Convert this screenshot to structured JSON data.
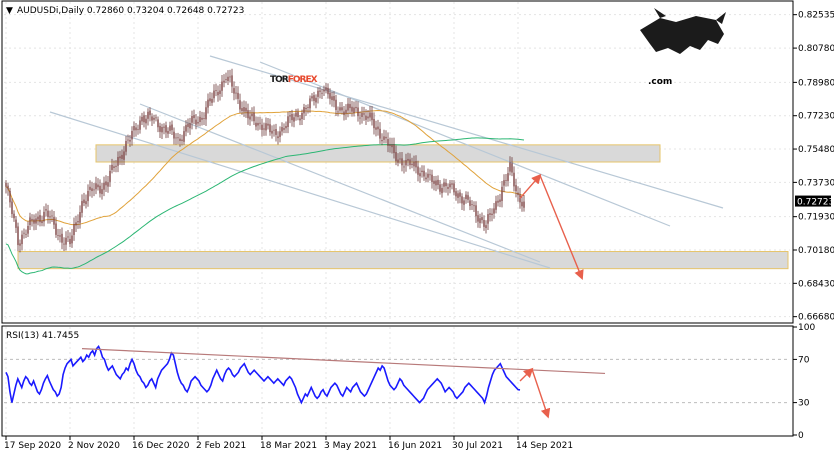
{
  "chart_data": [
    {
      "type": "candlestick",
      "title": "AUDUSDi,Daily  0.72860 0.73204 0.72648 0.72723",
      "symbol_marker": "▼",
      "current_price_label": "0.72723",
      "current_price": 0.72723,
      "ylim": [
        0.664,
        0.832
      ],
      "y_ticks": [
        "0.82535",
        "0.80780",
        "0.78980",
        "0.77230",
        "0.75480",
        "0.73730",
        "0.71930",
        "0.70180",
        "0.68430",
        "0.66680"
      ],
      "x_ticks": [
        "17 Sep 2020",
        "2 Nov 2020",
        "16 Dec 2020",
        "2 Feb 2021",
        "18 Mar 2021",
        "3 May 2021",
        "16 Jun 2021",
        "30 Jul 2021",
        "14 Sep 2021"
      ],
      "grid": true,
      "n_bars": 260,
      "closes_anchors": [
        [
          0,
          0.735
        ],
        [
          6,
          0.707
        ],
        [
          12,
          0.715
        ],
        [
          20,
          0.722
        ],
        [
          26,
          0.71
        ],
        [
          32,
          0.705
        ],
        [
          38,
          0.727
        ],
        [
          45,
          0.735
        ],
        [
          50,
          0.736
        ],
        [
          56,
          0.75
        ],
        [
          62,
          0.76
        ],
        [
          68,
          0.772
        ],
        [
          74,
          0.77
        ],
        [
          80,
          0.765
        ],
        [
          86,
          0.76
        ],
        [
          92,
          0.768
        ],
        [
          98,
          0.772
        ],
        [
          104,
          0.783
        ],
        [
          110,
          0.793
        ],
        [
          116,
          0.781
        ],
        [
          122,
          0.77
        ],
        [
          128,
          0.768
        ],
        [
          134,
          0.762
        ],
        [
          140,
          0.768
        ],
        [
          146,
          0.773
        ],
        [
          152,
          0.778
        ],
        [
          158,
          0.788
        ],
        [
          164,
          0.778
        ],
        [
          170,
          0.775
        ],
        [
          176,
          0.775
        ],
        [
          182,
          0.77
        ],
        [
          188,
          0.762
        ],
        [
          194,
          0.752
        ],
        [
          200,
          0.747
        ],
        [
          206,
          0.745
        ],
        [
          212,
          0.738
        ],
        [
          218,
          0.736
        ],
        [
          224,
          0.733
        ],
        [
          230,
          0.728
        ],
        [
          236,
          0.72
        ],
        [
          240,
          0.715
        ],
        [
          244,
          0.723
        ],
        [
          248,
          0.735
        ],
        [
          252,
          0.744
        ],
        [
          256,
          0.73
        ],
        [
          259,
          0.7272
        ]
      ],
      "sma_orange_color": "#e0a23a",
      "sma_green_color": "#2bb673",
      "zones": [
        {
          "from": 0.748,
          "to": 0.757
        },
        {
          "from": 0.692,
          "to": 0.701
        }
      ],
      "channel_color": "#b8c8d6",
      "forecast_color": "#e8604c",
      "forecast_points": [
        [
          520,
          0.729
        ],
        [
          540,
          0.741
        ],
        [
          582,
          0.687
        ]
      ]
    },
    {
      "type": "line",
      "title": "RSI(13) 41.7455",
      "ylim": [
        0,
        100
      ],
      "y_ticks": [
        "100",
        "70",
        "30",
        "0"
      ],
      "levels": [
        70,
        30
      ],
      "values": [
        58,
        54,
        40,
        30,
        38,
        46,
        52,
        48,
        44,
        50,
        54,
        52,
        48,
        46,
        50,
        45,
        40,
        38,
        42,
        48,
        52,
        55,
        50,
        46,
        42,
        40,
        36,
        38,
        44,
        56,
        62,
        66,
        68,
        70,
        64,
        66,
        68,
        70,
        72,
        68,
        70,
        74,
        72,
        76,
        78,
        74,
        80,
        82,
        78,
        72,
        70,
        64,
        60,
        62,
        64,
        60,
        56,
        54,
        52,
        56,
        58,
        62,
        60,
        66,
        70,
        66,
        60,
        56,
        54,
        50,
        48,
        44,
        46,
        50,
        52,
        48,
        44,
        52,
        56,
        60,
        62,
        64,
        66,
        70,
        76,
        74,
        66,
        58,
        52,
        48,
        46,
        42,
        40,
        44,
        50,
        52,
        54,
        52,
        50,
        46,
        44,
        42,
        40,
        42,
        46,
        52,
        56,
        60,
        56,
        52,
        50,
        56,
        60,
        62,
        60,
        56,
        54,
        56,
        58,
        62,
        64,
        66,
        62,
        58,
        56,
        58,
        60,
        58,
        56,
        54,
        52,
        50,
        52,
        54,
        52,
        50,
        48,
        50,
        52,
        50,
        48,
        46,
        50,
        52,
        54,
        52,
        48,
        44,
        38,
        34,
        30,
        34,
        38,
        36,
        40,
        44,
        40,
        36,
        34,
        36,
        40,
        42,
        38,
        36,
        40,
        44,
        46,
        48,
        46,
        42,
        38,
        36,
        40,
        44,
        42,
        40,
        44,
        46,
        48,
        44,
        40,
        38,
        36,
        38,
        42,
        46,
        50,
        54,
        58,
        62,
        60,
        64,
        62,
        56,
        50,
        46,
        44,
        42,
        44,
        48,
        52,
        50,
        46,
        44,
        42,
        40,
        38,
        36,
        34,
        32,
        30,
        32,
        34,
        38,
        42,
        44,
        46,
        48,
        50,
        52,
        50,
        48,
        44,
        40,
        42,
        44,
        42,
        40,
        36,
        34,
        36,
        38,
        40,
        44,
        46,
        48,
        46,
        44,
        42,
        40,
        38,
        36,
        34,
        30,
        36,
        44,
        50,
        56,
        60,
        62,
        64,
        66,
        62,
        58,
        54,
        52,
        50,
        48,
        46,
        44,
        42,
        41.7
      ],
      "trendline": [
        [
          82,
          80
        ],
        [
          605,
          57
        ]
      ],
      "line_color": "#1a1aff",
      "trendline_color": "#b87a7a",
      "forecast_points": [
        [
          520,
          50
        ],
        [
          532,
          61
        ],
        [
          548,
          17
        ]
      ]
    }
  ],
  "logo": {
    "part1": "TOR",
    "part2": "FOREX",
    "part3": ".com",
    "color_dark": "#1b1b1b",
    "color_accent": "#e8492e"
  }
}
